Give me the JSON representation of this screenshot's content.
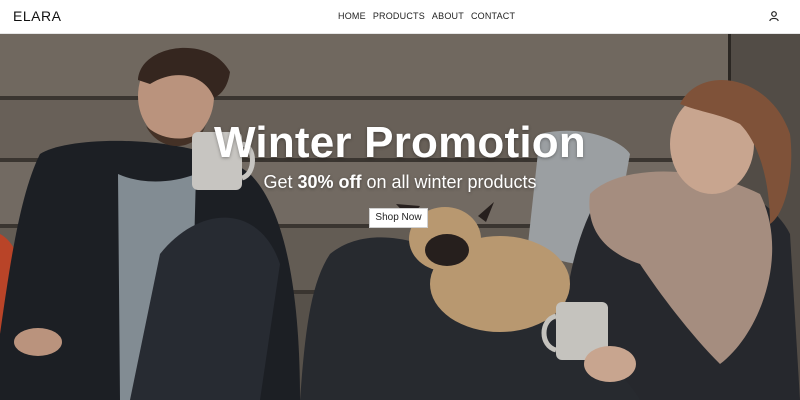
{
  "header": {
    "brand": "ELARA",
    "nav": [
      "HOME",
      "PRODUCTS",
      "ABOUT",
      "CONTACT"
    ],
    "user_icon": "user-icon"
  },
  "hero": {
    "headline": "Winter Promotion",
    "sub_prefix": "Get ",
    "sub_bold": "30% off",
    "sub_suffix": " on all winter products",
    "cta_label": "Shop Now",
    "image": "photo-couple-with-pug-on-wooden-porch"
  },
  "colors": {
    "hero_text": "#ffffff",
    "header_bg": "#ffffff"
  }
}
